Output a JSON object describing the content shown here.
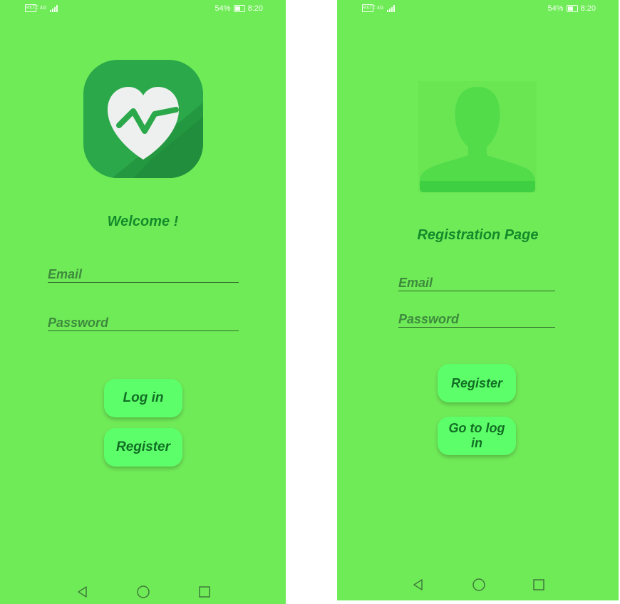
{
  "login_screen": {
    "status_bar": {
      "carrier_icon": "volte-icon",
      "network": "4G",
      "battery_percent": "54%",
      "time": "8:20"
    },
    "logo_icon": "heart-pulse-icon",
    "title": "Welcome !",
    "email_placeholder": "Email",
    "password_placeholder": "Password",
    "login_button": "Log in",
    "register_button": "Register"
  },
  "register_screen": {
    "status_bar": {
      "carrier_icon": "volte-icon",
      "network": "4G",
      "battery_percent": "54%",
      "time": "8:20"
    },
    "avatar_icon": "user-silhouette-icon",
    "title": "Registration Page",
    "email_placeholder": "Email",
    "password_placeholder": "Password",
    "register_button": "Register",
    "go_to_login_button": "Go to log in"
  },
  "navigation_bar": {
    "icons": [
      "back-icon",
      "home-icon",
      "recent-apps-icon"
    ]
  },
  "colors": {
    "background": "#70eb58",
    "button": "#5cff6a",
    "title_text": "#148a2a",
    "logo_bg": "#2aa84a"
  }
}
